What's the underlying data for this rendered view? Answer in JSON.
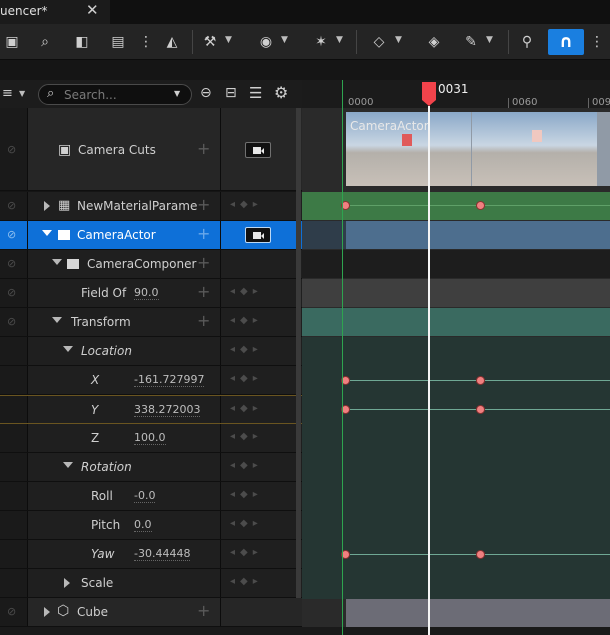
{
  "window": {
    "tab_title": "uencer*",
    "close_glyph": "✕"
  },
  "toolbar": {
    "icons": [
      "save-icon",
      "browse-icon",
      "render-camera-icon",
      "clapper-icon",
      "more-icon",
      "chart-icon",
      "wrench-icon",
      "eye-icon",
      "sparkle-icon",
      "diamond-icon",
      "curve-icon",
      "brush-icon",
      "pin-icon",
      "magnet-icon",
      "more-icon"
    ],
    "snap_active_color": "#1a7fe0"
  },
  "search": {
    "placeholder": "Search..."
  },
  "timeline": {
    "playhead_frame": "0031",
    "ruler_labels": [
      "0000",
      "0060",
      "009"
    ],
    "cut_clip_label": "CameraActor"
  },
  "tracks": [
    {
      "label": "Camera Cuts"
    },
    {
      "label": "NewMaterialParame"
    },
    {
      "label": "CameraActor"
    },
    {
      "label": "CameraComponer"
    },
    {
      "label": "Field Of",
      "value": "90.0"
    },
    {
      "label": "Transform"
    },
    {
      "label": "Location"
    },
    {
      "label": "X",
      "value": "-161.727997"
    },
    {
      "label": "Y",
      "value": "338.272003"
    },
    {
      "label": "Z",
      "value": "100.0"
    },
    {
      "label": "Rotation"
    },
    {
      "label": "Roll",
      "value": "-0.0"
    },
    {
      "label": "Pitch",
      "value": "0.0"
    },
    {
      "label": "Yaw",
      "value": "-30.44448"
    },
    {
      "label": "Scale"
    },
    {
      "label": "Cube"
    }
  ],
  "colors": {
    "selection": "#0e70d8",
    "playhead": "#f2434b",
    "key": "#f08080",
    "material_track": "#3d7a46",
    "camera_track": "#4d6e8e",
    "transform_track": "#3a6a60"
  }
}
